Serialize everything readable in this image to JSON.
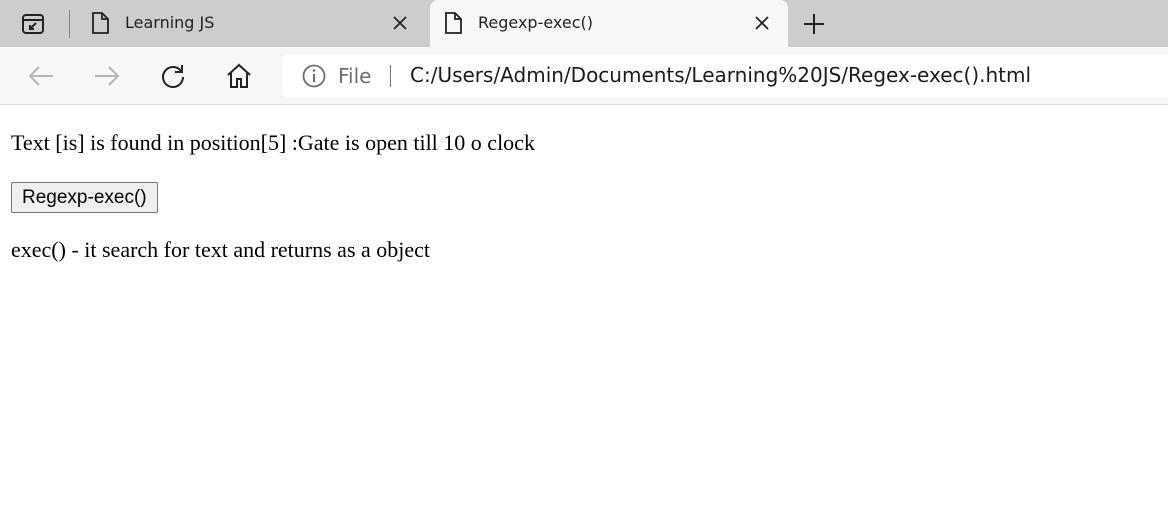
{
  "browser": {
    "tabs": [
      {
        "title": "Learning JS",
        "active": false
      },
      {
        "title": "Regexp-exec()",
        "active": true
      }
    ],
    "address": {
      "scheme_label": "File",
      "url": "C:/Users/Admin/Documents/Learning%20JS/Regex-exec().html"
    },
    "icons": {
      "tab_actions": "tab-actions-icon",
      "new_tab": "plus-icon",
      "back": "back-arrow-icon",
      "forward": "forward-arrow-icon",
      "refresh": "refresh-icon",
      "home": "home-icon",
      "info": "info-icon",
      "page": "page-icon",
      "close": "close-icon"
    }
  },
  "page": {
    "result_text": "Text [is] is found in position[5] :Gate is open till 10 o clock",
    "button_label": "Regexp-exec()",
    "description": "exec() - it search for text and returns as a object"
  }
}
